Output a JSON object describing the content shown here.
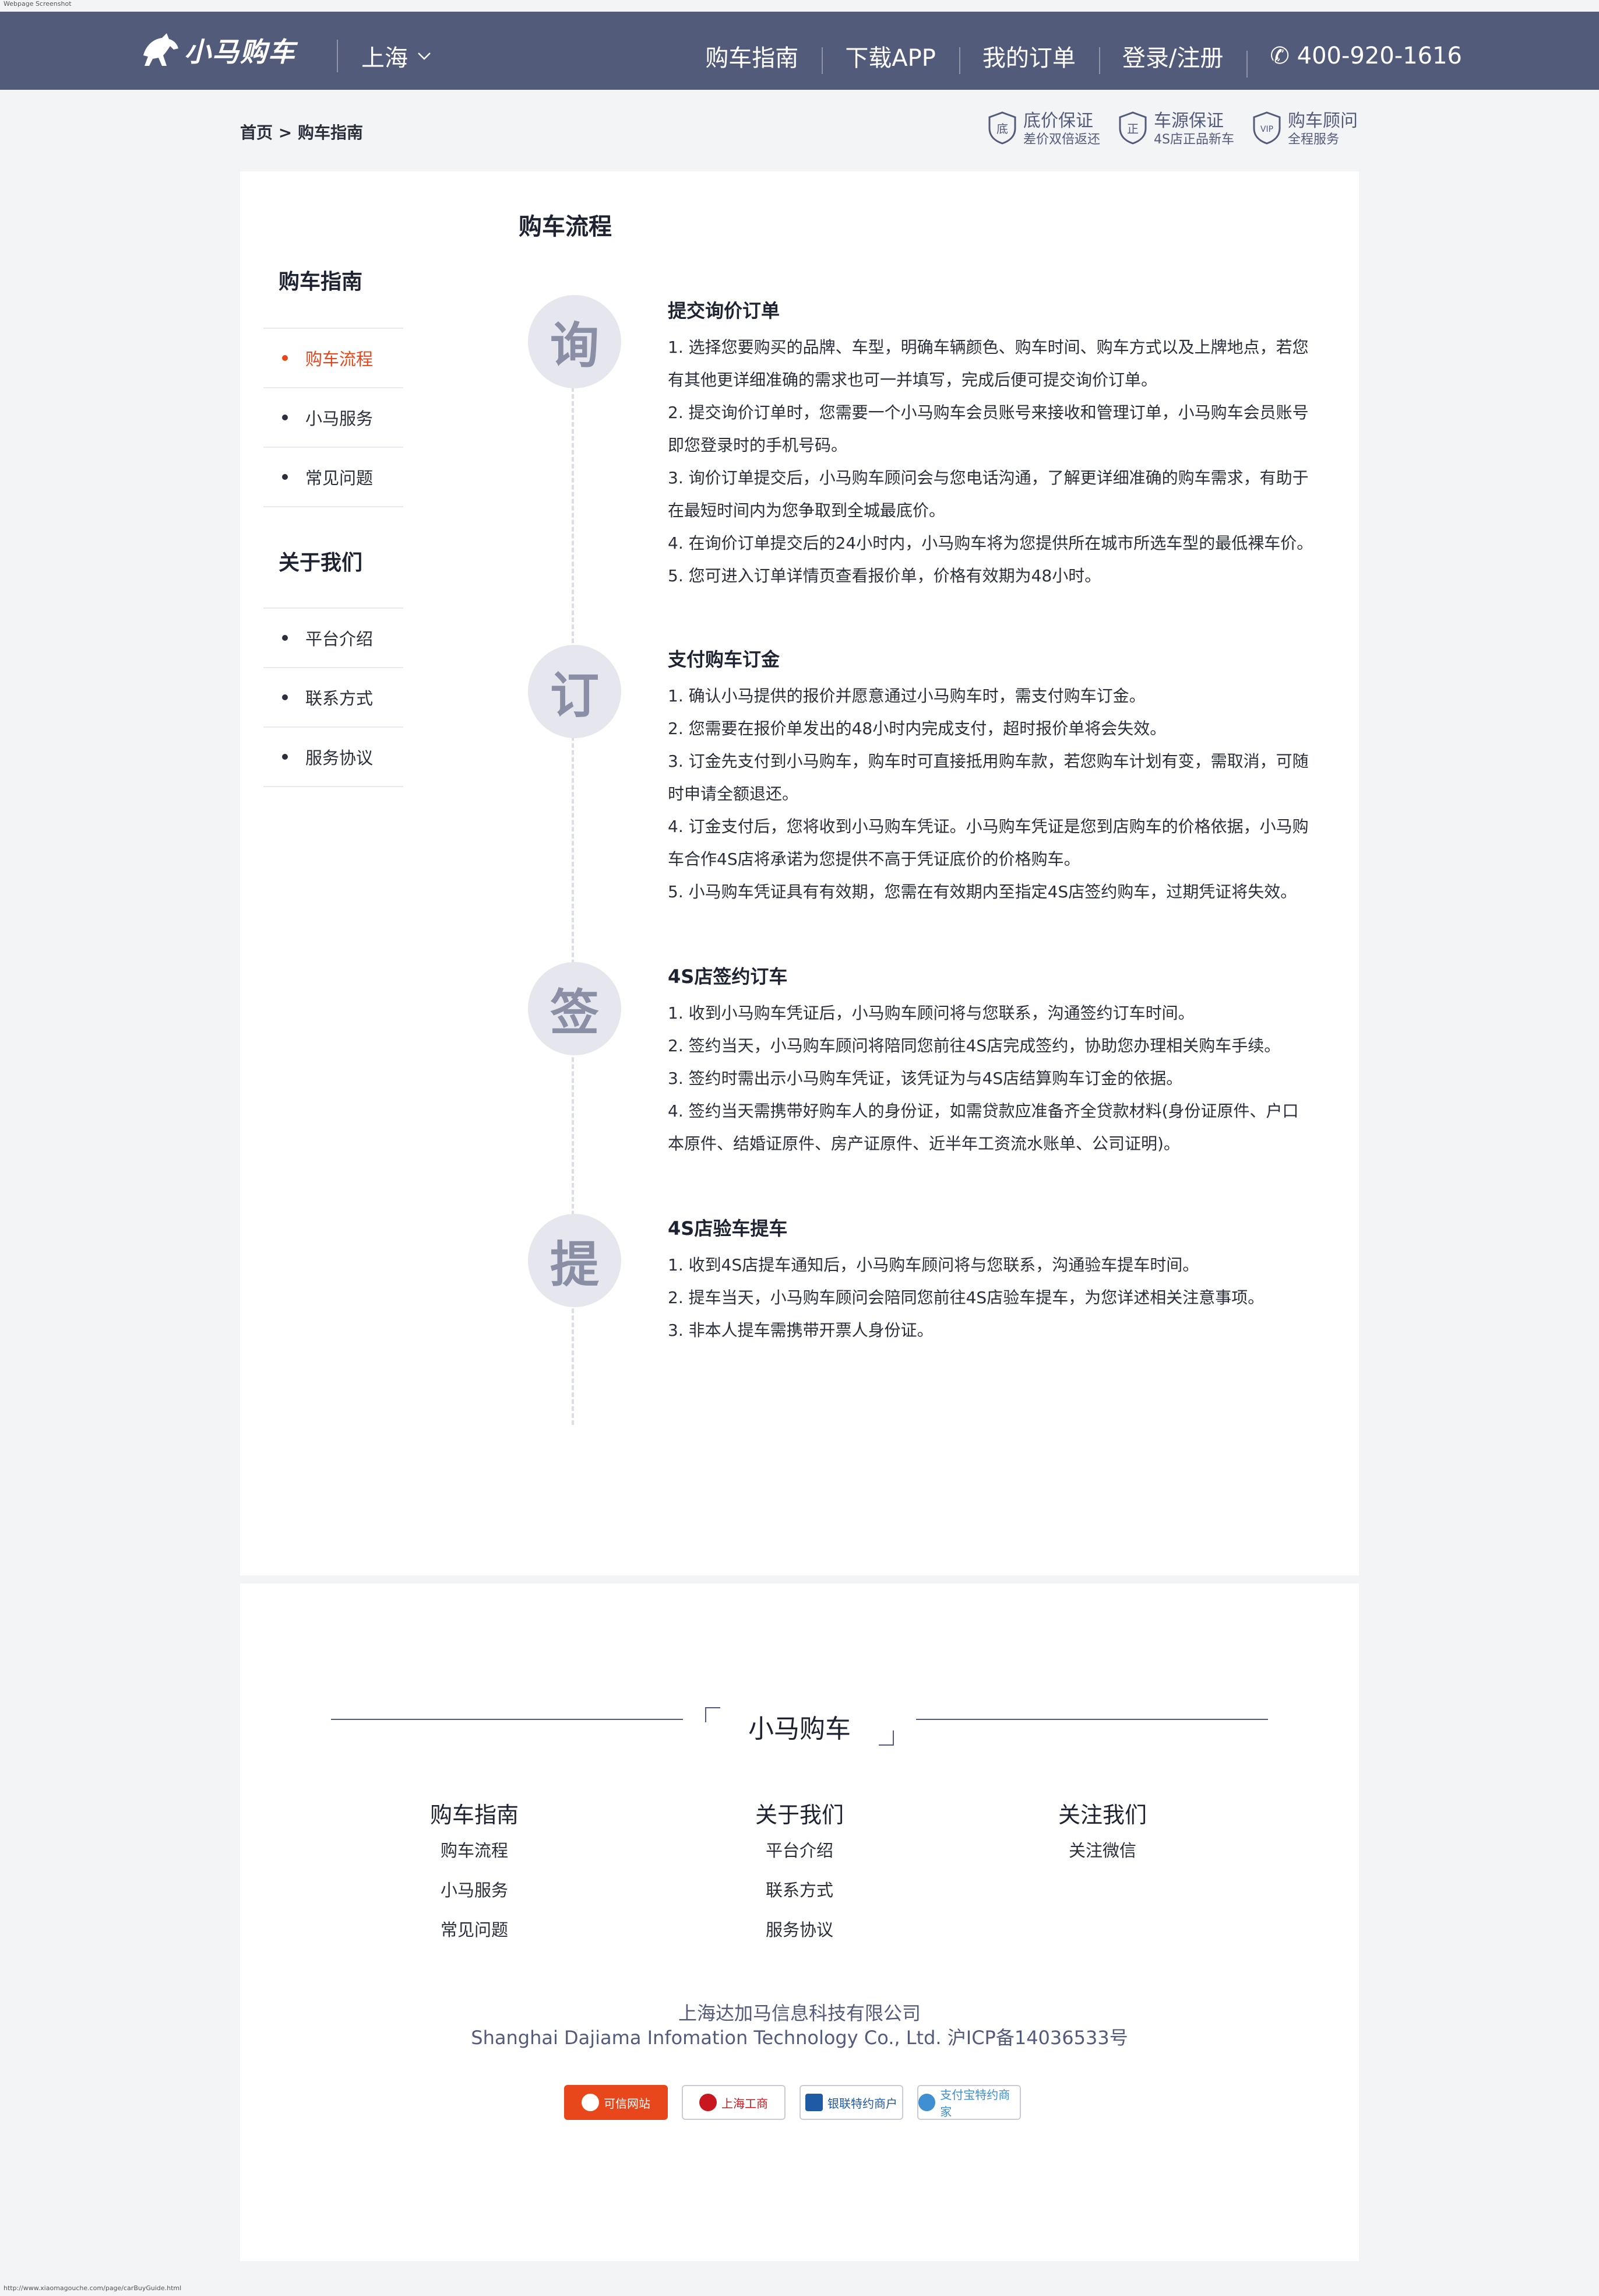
{
  "screen_caption": "Webpage Screenshot",
  "url_caption": "http://www.xiaomagouche.com/page/carBuyGuide.html",
  "colors": {
    "header_bg": "#535b7b",
    "accent": "#e8471c",
    "page_bg": "#f3f4f6"
  },
  "header": {
    "brand": "小马购车",
    "logo_icon": "horse-icon",
    "city": "上海",
    "nav": [
      "购车指南",
      "下载APP",
      "我的订单",
      "登录/注册"
    ],
    "phone": "✆ 400-920-1616"
  },
  "breadcrumb": {
    "home": "首页",
    "sep": " > ",
    "current": "购车指南"
  },
  "guarantees": [
    {
      "icon": "底",
      "title": "底价保证",
      "sub": "差价双倍返还"
    },
    {
      "icon": "正",
      "title": "车源保证",
      "sub": "4S店正品新车"
    },
    {
      "icon": "VIP",
      "title": "购车顾问",
      "sub": "全程服务"
    }
  ],
  "sidebar": {
    "guide_title": "购车指南",
    "guide_items": [
      "购车流程",
      "小马服务",
      "常见问题"
    ],
    "about_title": "关于我们",
    "about_items": [
      "平台介绍",
      "联系方式",
      "服务协议"
    ]
  },
  "process": {
    "title": "购车流程",
    "steps": [
      {
        "badge": "询",
        "title": "提交询价订单",
        "lines": [
          "1.   选择您要购买的品牌、车型，明确车辆颜色、购车时间、购车方式以及上牌地点，若您",
          "有其他更详细准确的需求也可一并填写，完成后便可提交询价订单。",
          "2.   提交询价订单时，您需要一个小马购车会员账号来接收和管理订单，小马购车会员账号",
          "即您登录时的手机号码。",
          "3.   询价订单提交后，小马购车顾问会与您电话沟通，了解更详细准确的购车需求，有助于",
          "在最短时间内为您争取到全城最底价。",
          "4.   在询价订单提交后的24小时内，小马购车将为您提供所在城市所选车型的最低裸车价。",
          "5.   您可进入订单详情页查看报价单，价格有效期为48小时。"
        ]
      },
      {
        "badge": "订",
        "title": "支付购车订金",
        "lines": [
          "1.   确认小马提供的报价并愿意通过小马购车时，需支付购车订金。",
          "2.   您需要在报价单发出的48小时内完成支付，超时报价单将会失效。",
          "3.   订金先支付到小马购车，购车时可直接抵用购车款，若您购车计划有变，需取消，可随",
          "时申请全额退还。",
          "4.   订金支付后，您将收到小马购车凭证。小马购车凭证是您到店购车的价格依据，小马购",
          "车合作4S店将承诺为您提供不高于凭证底价的价格购车。",
          "5.   小马购车凭证具有有效期，您需在有效期内至指定4S店签约购车，过期凭证将失效。"
        ]
      },
      {
        "badge": "签",
        "title": "4S店签约订车",
        "lines": [
          "1.   收到小马购车凭证后，小马购车顾问将与您联系，沟通签约订车时间。",
          "2.   签约当天，小马购车顾问将陪同您前往4S店完成签约，协助您办理相关购车手续。",
          "3.   签约时需出示小马购车凭证，该凭证为与4S店结算购车订金的依据。",
          "4.   签约当天需携带好购车人的身份证，如需贷款应准备齐全贷款材料(身份证原件、户口",
          "本原件、结婚证原件、房产证原件、近半年工资流水账单、公司证明)。"
        ]
      },
      {
        "badge": "提",
        "title": "4S店验车提车",
        "lines": [
          "1.   收到4S店提车通知后，小马购车顾问将与您联系，沟通验车提车时间。",
          "2.   提车当天，小马购车顾问会陪同您前往4S店验车提车，为您详述相关注意事项。",
          "3.   非本人提车需携带开票人身份证。"
        ]
      }
    ]
  },
  "footer": {
    "brand": "小马购车",
    "columns": [
      {
        "title": "购车指南",
        "links": [
          "购车流程",
          "小马服务",
          "常见问题"
        ]
      },
      {
        "title": "关于我们",
        "links": [
          "平台介绍",
          "联系方式",
          "服务协议"
        ]
      },
      {
        "title": "关注我们",
        "links": [
          "关注微信"
        ]
      }
    ],
    "company_cn": "上海达加马信息科技有限公司",
    "company_en": "Shanghai Dajiama Infomation Technology Co., Ltd. 沪ICP备14036533号",
    "badges": [
      {
        "label": "可信网站",
        "color": "#e8471c"
      },
      {
        "label": "上海工商",
        "color": "#c8171e"
      },
      {
        "label": "银联特约商户",
        "color": "#1f5aa6"
      },
      {
        "label": "支付宝特约商家",
        "color": "#3f8fd2"
      }
    ]
  }
}
